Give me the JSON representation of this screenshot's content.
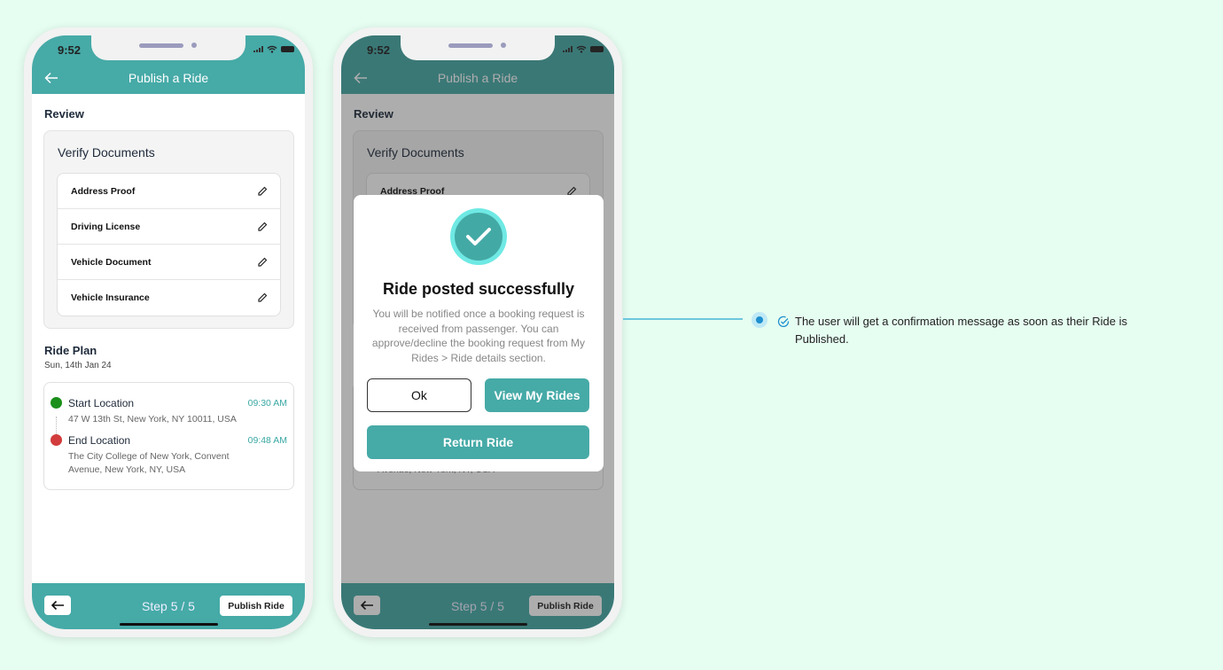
{
  "colors": {
    "brand": "#46aaa7",
    "background": "#e6fdf1",
    "start_dot": "#1a8f1a",
    "end_dot": "#d23c3c",
    "accent_blue": "#1f8fcf"
  },
  "phone1": {
    "status": {
      "time": "9:52"
    },
    "header": {
      "title": "Publish a Ride",
      "back_icon": "arrow-left-icon"
    },
    "review_label": "Review",
    "verify": {
      "title": "Verify Documents",
      "items": [
        {
          "label": "Address Proof",
          "icon": "pencil-icon"
        },
        {
          "label": "Driving License",
          "icon": "pencil-icon"
        },
        {
          "label": "Vehicle Document",
          "icon": "pencil-icon"
        },
        {
          "label": "Vehicle Insurance",
          "icon": "pencil-icon"
        }
      ]
    },
    "ride_plan": {
      "title": "Ride Plan",
      "date": "Sun, 14th Jan 24",
      "start": {
        "name": "Start Location",
        "time": "09:30 AM",
        "address": "47 W 13th St, New York, NY 10011, USA"
      },
      "end": {
        "name": "End Location",
        "time": "09:48 AM",
        "address": "The City College of New York, Convent Avenue, New York, NY, USA"
      }
    },
    "footer": {
      "step": "Step 5 / 5",
      "publish": "Publish Ride"
    }
  },
  "phone2": {
    "status": {
      "time": "9:52"
    },
    "header": {
      "title": "Publish a Ride"
    },
    "review_label": "Review",
    "verify": {
      "title": "Verify Documents",
      "first_item": "Address Proof"
    },
    "background_addr_tail": "Avenue, New York, NY, USA",
    "modal": {
      "icon": "check-circle-icon",
      "title": "Ride posted successfully",
      "message": "You will be notified once a booking request is received from passenger. You can approve/decline the booking request from My Rides > Ride details section.",
      "ok": "Ok",
      "view_rides": "View My Rides",
      "return_ride": "Return Ride"
    },
    "footer": {
      "step": "Step 5 / 5",
      "publish": "Publish Ride"
    }
  },
  "annotation": {
    "text": "The user will get a confirmation message as soon as their Ride is Published."
  }
}
